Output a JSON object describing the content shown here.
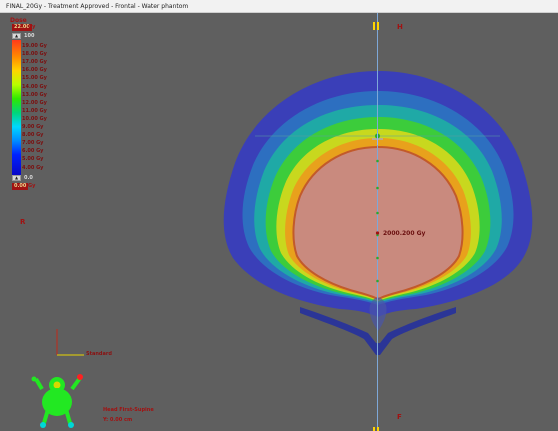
{
  "window": {
    "title": "FINAL_20Gy - Treatment Approved - Frontal - Water phantom"
  },
  "legend": {
    "title": "Dose",
    "max_value": "22.00",
    "max_unit": "Gy",
    "top_toggle_label": "100",
    "min_value": "0.00",
    "min_unit": "Gy",
    "bottom_toggle_label": "0.0",
    "ticks": [
      "19.00 Gy",
      "18.00 Gy",
      "17.00 Gy",
      "16.00 Gy",
      "15.00 Gy",
      "14.00 Gy",
      "13.00 Gy",
      "12.00 Gy",
      "11.00 Gy",
      "10.00 Gy",
      "9.00 Gy",
      "8.00 Gy",
      "7.00 Gy",
      "6.00 Gy",
      "5.00 Gy",
      "4.00 Gy"
    ],
    "gradient_colors": [
      "#ff3a1a",
      "#ff8a00",
      "#ffd500",
      "#b8ff00",
      "#2ee800",
      "#00d67a",
      "#00d7ff",
      "#008cff",
      "#0022ff",
      "#0b00b8"
    ]
  },
  "orientation": {
    "top": "H",
    "bottom": "F",
    "left": "R"
  },
  "dose_point": {
    "value": "2000.200 Gy"
  },
  "scale": {
    "label": "Standard"
  },
  "patient": {
    "position": "Head First-Supine",
    "slice": "Y: 0.00 cm"
  },
  "colors": {
    "background": "#5f5f5f",
    "label_red": "#a11212",
    "isocenter_axis": "#7ea8d8",
    "orientation_marker": "#ffd400",
    "body_icon": "#22e822"
  }
}
